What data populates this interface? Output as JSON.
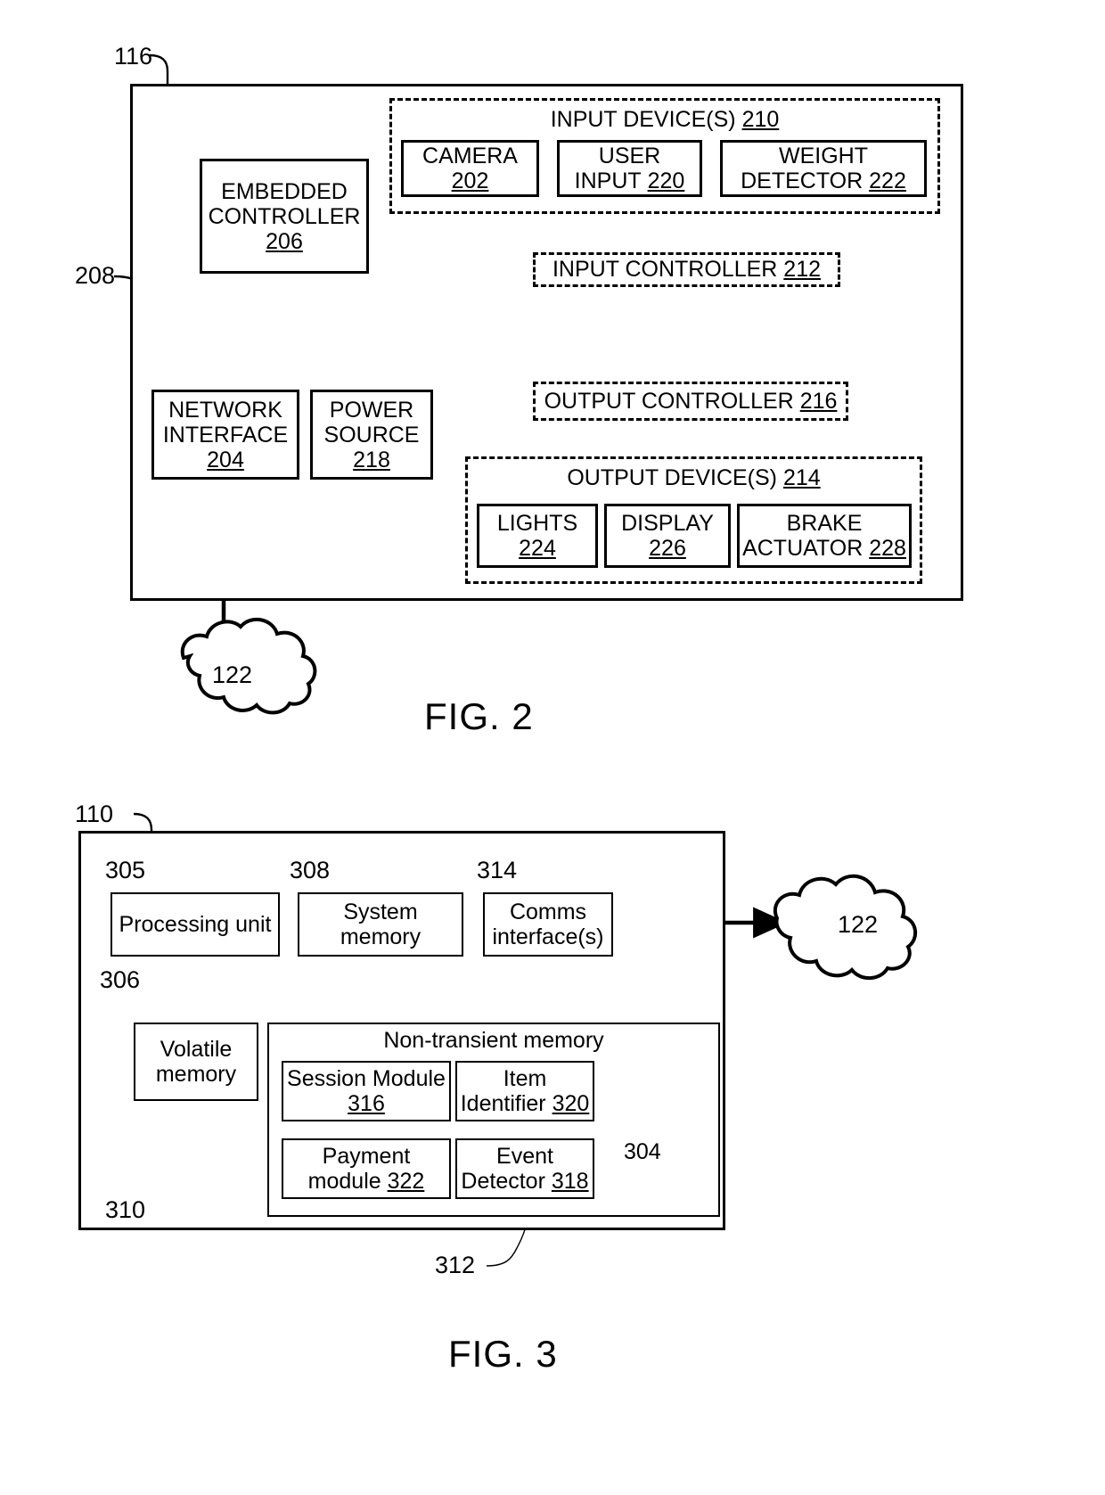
{
  "figures": [
    {
      "id": "fig2",
      "caption": "FIG. 2",
      "outer_ref": "116",
      "bus_ref": "208",
      "cloud_label": "122",
      "groups": [
        {
          "name": "input-devices",
          "title_text": "INPUT DEVICE(S)",
          "title_ref": "210"
        },
        {
          "name": "output-devices",
          "title_text": "OUTPUT DEVICE(S)",
          "title_ref": "214"
        }
      ],
      "blocks": [
        {
          "name": "embedded-controller",
          "line1": "EMBEDDED",
          "line2": "CONTROLLER",
          "ref": "206"
        },
        {
          "name": "camera",
          "line1": "CAMERA",
          "line2": "",
          "ref": "202"
        },
        {
          "name": "user-input",
          "line1": "USER",
          "line2": "INPUT",
          "ref": "220"
        },
        {
          "name": "weight-detector",
          "line1": "WEIGHT",
          "line2": "DETECTOR",
          "ref": "222"
        },
        {
          "name": "input-controller",
          "line1": "INPUT CONTROLLER",
          "line2": "",
          "ref": "212"
        },
        {
          "name": "output-controller",
          "line1": "OUTPUT CONTROLLER",
          "line2": "",
          "ref": "216"
        },
        {
          "name": "network-interface",
          "line1": "NETWORK",
          "line2": "INTERFACE",
          "ref": "204"
        },
        {
          "name": "power-source",
          "line1": "POWER",
          "line2": "SOURCE",
          "ref": "218"
        },
        {
          "name": "lights",
          "line1": "LIGHTS",
          "line2": "",
          "ref": "224"
        },
        {
          "name": "display",
          "line1": "DISPLAY",
          "line2": "",
          "ref": "226"
        },
        {
          "name": "brake-actuator",
          "line1": "BRAKE",
          "line2": "ACTUATOR",
          "ref": "228"
        }
      ]
    },
    {
      "id": "fig3",
      "caption": "FIG. 3",
      "outer_ref": "110",
      "bus_ref": "306",
      "cloud_label": "122",
      "memory_title": "Non-transient memory",
      "memory_ref": "312",
      "volatile_ref": "310",
      "database_label": "304",
      "blocks": [
        {
          "name": "processing-unit",
          "line1": "Processing unit",
          "line2": "",
          "ref": "305"
        },
        {
          "name": "system-memory",
          "line1": "System",
          "line2": "memory",
          "ref": "308"
        },
        {
          "name": "comms-interfaces",
          "line1": "Comms",
          "line2": "interface(s)",
          "ref": "314"
        },
        {
          "name": "volatile-memory",
          "line1": "Volatile",
          "line2": "memory",
          "ref": ""
        },
        {
          "name": "session-module",
          "line1": "Session Module",
          "line2": "",
          "ref": "316"
        },
        {
          "name": "item-identifier",
          "line1": "Item",
          "line2": "Identifier",
          "ref": "320"
        },
        {
          "name": "payment-module",
          "line1": "Payment",
          "line2": "module",
          "ref": "322"
        },
        {
          "name": "event-detector",
          "line1": "Event",
          "line2": "Detector",
          "ref": "318"
        }
      ]
    }
  ],
  "fig2": {
    "outer_ref": "116",
    "bus_ref": "208",
    "caption": "FIG. 2",
    "cloud_label": "122",
    "input_group_title": "INPUT DEVICE(S)",
    "input_group_ref": "210",
    "output_group_title": "OUTPUT DEVICE(S)",
    "output_group_ref": "214",
    "embedded_controller_l1": "EMBEDDED",
    "embedded_controller_l2": "CONTROLLER",
    "embedded_controller_ref": "206",
    "camera_l1": "CAMERA",
    "camera_ref": "202",
    "user_input_l1": "USER",
    "user_input_l2": "INPUT",
    "user_input_ref": "220",
    "weight_detector_l1": "WEIGHT",
    "weight_detector_l2": "DETECTOR",
    "weight_detector_ref": "222",
    "input_controller_text": "INPUT CONTROLLER",
    "input_controller_ref": "212",
    "output_controller_text": "OUTPUT CONTROLLER",
    "output_controller_ref": "216",
    "network_interface_l1": "NETWORK",
    "network_interface_l2": "INTERFACE",
    "network_interface_ref": "204",
    "power_source_l1": "POWER",
    "power_source_l2": "SOURCE",
    "power_source_ref": "218",
    "lights_l1": "LIGHTS",
    "lights_ref": "224",
    "display_l1": "DISPLAY",
    "display_ref": "226",
    "brake_l1": "BRAKE",
    "brake_l2": "ACTUATOR",
    "brake_ref": "228"
  },
  "fig3": {
    "outer_ref": "110",
    "bus_ref": "306",
    "caption": "FIG. 3",
    "cloud_label": "122",
    "processing_unit": "Processing unit",
    "processing_unit_ref": "305",
    "system_memory_l1": "System",
    "system_memory_l2": "memory",
    "system_memory_ref": "308",
    "comms_l1": "Comms",
    "comms_l2": "interface(s)",
    "comms_ref": "314",
    "volatile_l1": "Volatile",
    "volatile_l2": "memory",
    "volatile_ref": "310",
    "memory_title": "Non-transient memory",
    "memory_ref": "312",
    "session_module_l1": "Session Module",
    "session_module_ref": "316",
    "item_identifier_l1": "Item",
    "item_identifier_l2": "Identifier",
    "item_identifier_ref": "320",
    "payment_module_l1": "Payment",
    "payment_module_l2": "module",
    "payment_module_ref": "322",
    "event_detector_l1": "Event",
    "event_detector_l2": "Detector",
    "event_detector_ref": "318",
    "database_label": "304"
  }
}
